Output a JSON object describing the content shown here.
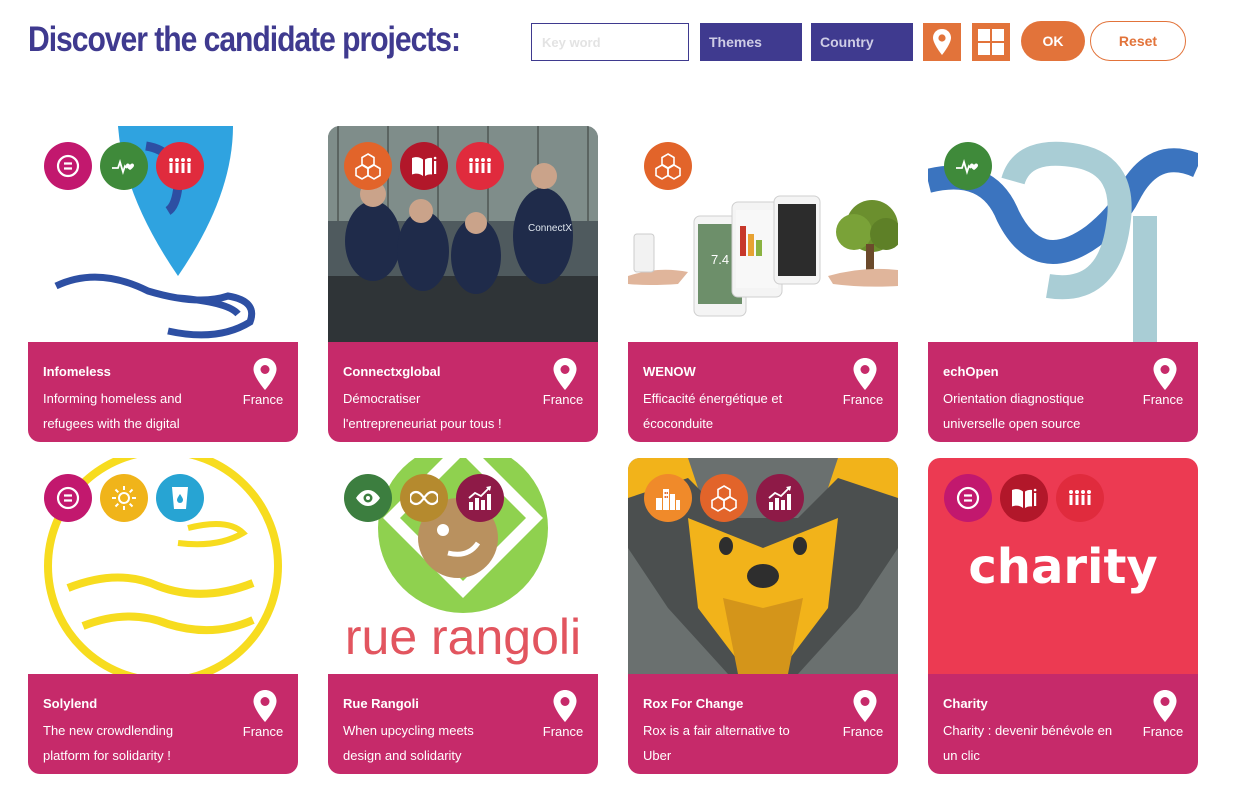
{
  "header": {
    "title": "Discover the candidate projects:",
    "keyword_placeholder": "Key word",
    "themes_label": "Themes",
    "country_label": "Country",
    "ok_label": "OK",
    "reset_label": "Reset"
  },
  "colors": {
    "brand_purple": "#3f3a8f",
    "accent_orange": "#e2733a",
    "card_footer": "#c62a6a"
  },
  "projects": [
    {
      "name": "Infomeless",
      "desc": "Informing homeless and refugees with the digital",
      "country": "France",
      "badges": [
        "equality-icon",
        "health-icon",
        "people-icon"
      ]
    },
    {
      "name": "Connectxglobal",
      "desc": "Démocratiser l'entrepreneuriat pour tous !",
      "country": "France",
      "badges": [
        "cubes-icon",
        "education-icon",
        "people-icon"
      ]
    },
    {
      "name": "WENOW",
      "desc": "Efficacité énergétique et écoconduite",
      "country": "France",
      "badges": [
        "cubes-icon"
      ]
    },
    {
      "name": "echOpen",
      "desc": "Orientation diagnostique universelle open source",
      "country": "France",
      "badges": [
        "health-icon"
      ]
    },
    {
      "name": "Solylend",
      "desc": "The new crowdlending platform for solidarity !",
      "country": "France",
      "badges": [
        "equality-icon",
        "sun-icon",
        "water-icon"
      ]
    },
    {
      "name": "Rue Rangoli",
      "desc": "When upcycling meets design and solidarity",
      "country": "France",
      "badges": [
        "eye-icon",
        "infinity-icon",
        "growth-icon"
      ]
    },
    {
      "name": "Rox For Change",
      "desc": "Rox is a fair alternative to Uber",
      "country": "France",
      "badges": [
        "city-icon",
        "cubes-icon",
        "growth-icon"
      ]
    },
    {
      "name": "Charity",
      "desc": "Charity : devenir bénévole en un clic",
      "country": "France",
      "badges": [
        "equality-icon",
        "education-icon",
        "people-icon"
      ]
    }
  ],
  "thumbs": {
    "connectx_banner": "ConnectX",
    "rangoli_text": "rue rangoli",
    "charity_text": "charity",
    "wenow_value": "7.4"
  }
}
